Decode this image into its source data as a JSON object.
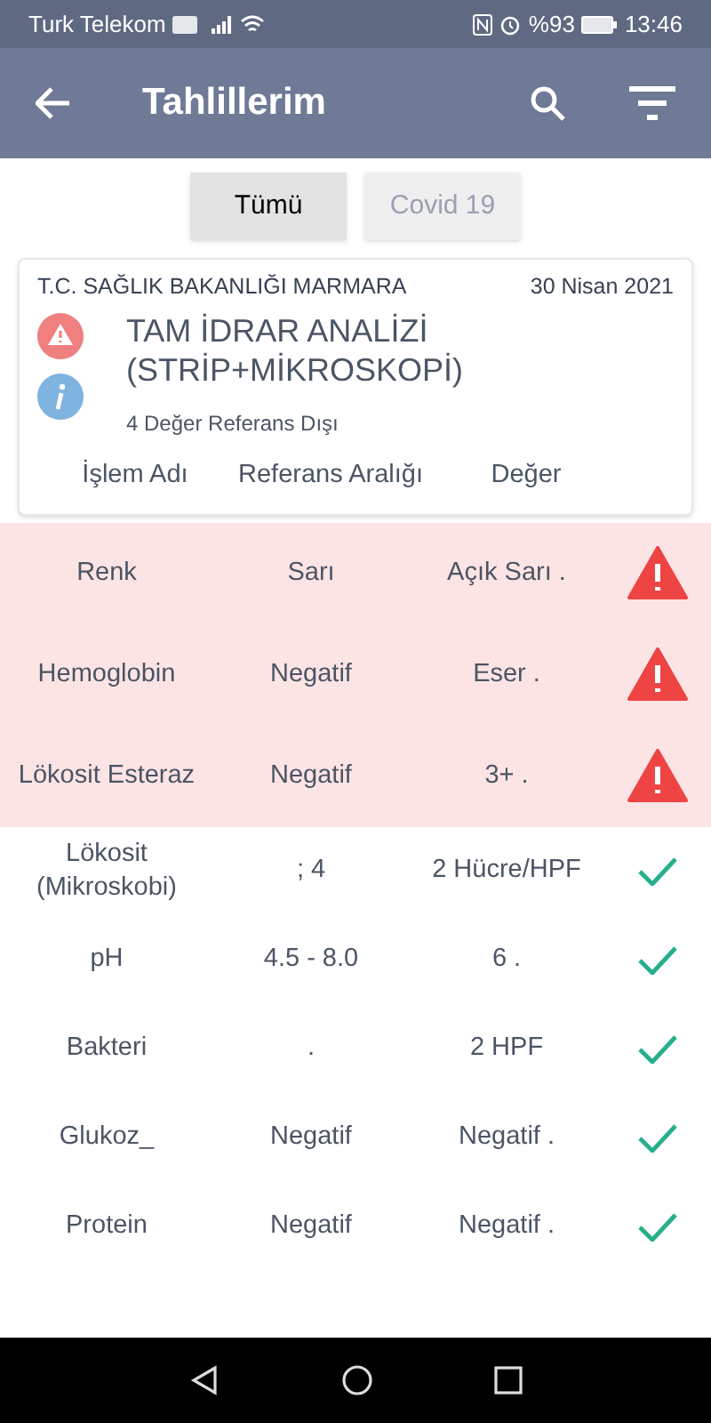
{
  "status_bar": {
    "carrier": "Turk Telekom",
    "battery": "%93",
    "time": "13:46"
  },
  "app_bar": {
    "title": "Tahlillerim"
  },
  "tabs": [
    {
      "label": "Tümü",
      "selected": true
    },
    {
      "label": "Covid 19",
      "selected": false
    }
  ],
  "report": {
    "institution": "T.C. SAĞLIK BAKANLIĞI MARMARA",
    "date": "30 Nisan 2021",
    "title": "TAM İDRAR ANALİZİ (STRİP+MİKROSKOPİ)",
    "summary": "4 Değer Referans Dışı",
    "columns": [
      "İşlem Adı",
      "Referans Aralığı",
      "Değer"
    ]
  },
  "rows": [
    {
      "name": "Renk",
      "reference": "Sarı",
      "value": "Açık Sarı .",
      "out_of_range": true
    },
    {
      "name": "Hemoglobin",
      "reference": "Negatif",
      "value": "Eser .",
      "out_of_range": true
    },
    {
      "name": "Lökosit Esteraz",
      "reference": "Negatif",
      "value": "3+ .",
      "out_of_range": true
    },
    {
      "name": "Lökosit (Mikroskobi)",
      "reference": "; 4",
      "value": "2 Hücre/HPF",
      "out_of_range": false
    },
    {
      "name": "pH",
      "reference": "4.5 - 8.0",
      "value": "6 .",
      "out_of_range": false
    },
    {
      "name": "Bakteri",
      "reference": ".",
      "value": "2 HPF",
      "out_of_range": false
    },
    {
      "name": "Glukoz_",
      "reference": "Negatif",
      "value": "Negatif .",
      "out_of_range": false
    },
    {
      "name": "Protein",
      "reference": "Negatif",
      "value": "Negatif .",
      "out_of_range": false
    }
  ]
}
